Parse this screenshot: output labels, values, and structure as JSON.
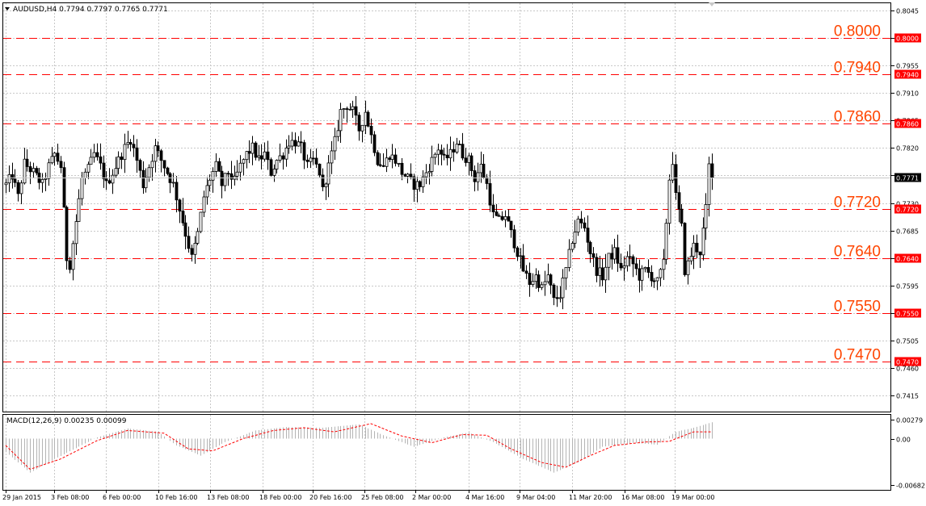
{
  "window": {
    "symbol_header": "AUDUSD,H4 0.7794 0.7797 0.7765 0.7771",
    "menu_icon": "triangle-down-icon"
  },
  "colors": {
    "level": "#ff0000",
    "level_text": "#ff4500",
    "candle": "#000000",
    "grid": "#c8c8c8",
    "macd_hist": "#b4b4b4",
    "macd_signal": "#ff0000"
  },
  "chart_data": [
    {
      "type": "candlestick",
      "title": "AUDUSD,H4 0.7794 0.7797 0.7765 0.7771",
      "ylim": [
        0.7415,
        0.8045
      ],
      "y_ticks": [
        "0.8045",
        "0.8000",
        "0.7955",
        "0.7910",
        "0.7865",
        "0.7820",
        "0.7775",
        "0.7730",
        "0.7685",
        "0.7640",
        "0.7595",
        "0.7550",
        "0.7505",
        "0.7460",
        "0.7415"
      ],
      "x_ticks": [
        "29 Jan 2015",
        "3 Feb 08:00",
        "6 Feb 00:00",
        "10 Feb 16:00",
        "13 Feb 08:00",
        "18 Feb 00:00",
        "20 Feb 16:00",
        "25 Feb 08:00",
        "2 Mar 00:00",
        "4 Mar 16:00",
        "9 Mar 04:00",
        "11 Mar 20:00",
        "16 Mar 08:00",
        "19 Mar 00:00"
      ],
      "current_price": "0.7771",
      "levels": [
        {
          "value": 0.8,
          "label": "0.8000"
        },
        {
          "value": 0.794,
          "label": "0.7940"
        },
        {
          "value": 0.786,
          "label": "0.7860"
        },
        {
          "value": 0.772,
          "label": "0.7720"
        },
        {
          "value": 0.764,
          "label": "0.7640"
        },
        {
          "value": 0.755,
          "label": "0.7550"
        },
        {
          "value": 0.747,
          "label": "0.7470"
        }
      ],
      "close_path": [
        [
          0,
          0.776
        ],
        [
          2,
          0.7775
        ],
        [
          4,
          0.774
        ],
        [
          6,
          0.7795
        ],
        [
          9,
          0.778
        ],
        [
          12,
          0.776
        ],
        [
          14,
          0.779
        ],
        [
          16,
          0.781
        ],
        [
          18,
          0.779
        ],
        [
          20,
          0.764
        ],
        [
          21,
          0.763
        ],
        [
          23,
          0.77
        ],
        [
          25,
          0.777
        ],
        [
          27,
          0.7785
        ],
        [
          29,
          0.781
        ],
        [
          31,
          0.779
        ],
        [
          33,
          0.776
        ],
        [
          35,
          0.778
        ],
        [
          37,
          0.78
        ],
        [
          39,
          0.782
        ],
        [
          41,
          0.7835
        ],
        [
          43,
          0.78
        ],
        [
          45,
          0.776
        ],
        [
          47,
          0.779
        ],
        [
          49,
          0.782
        ],
        [
          51,
          0.78
        ],
        [
          53,
          0.778
        ],
        [
          55,
          0.776
        ],
        [
          57,
          0.772
        ],
        [
          59,
          0.768
        ],
        [
          61,
          0.764
        ],
        [
          63,
          0.768
        ],
        [
          65,
          0.774
        ],
        [
          67,
          0.777
        ],
        [
          69,
          0.779
        ],
        [
          71,
          0.776
        ],
        [
          73,
          0.778
        ],
        [
          75,
          0.7765
        ],
        [
          77,
          0.779
        ],
        [
          79,
          0.781
        ],
        [
          81,
          0.782
        ],
        [
          83,
          0.78
        ],
        [
          85,
          0.781
        ],
        [
          87,
          0.778
        ],
        [
          89,
          0.78
        ],
        [
          91,
          0.781
        ],
        [
          93,
          0.783
        ],
        [
          95,
          0.783
        ],
        [
          97,
          0.782
        ],
        [
          99,
          0.779
        ],
        [
          101,
          0.78
        ],
        [
          103,
          0.778
        ],
        [
          104,
          0.775
        ],
        [
          106,
          0.779
        ],
        [
          108,
          0.783
        ],
        [
          110,
          0.788
        ],
        [
          112,
          0.789
        ],
        [
          114,
          0.788
        ],
        [
          116,
          0.785
        ],
        [
          118,
          0.788
        ],
        [
          120,
          0.784
        ],
        [
          122,
          0.78
        ],
        [
          124,
          0.779
        ],
        [
          126,
          0.781
        ],
        [
          128,
          0.78
        ],
        [
          130,
          0.778
        ],
        [
          132,
          0.777
        ],
        [
          134,
          0.776
        ],
        [
          136,
          0.776
        ],
        [
          138,
          0.778
        ],
        [
          140,
          0.78
        ],
        [
          142,
          0.782
        ],
        [
          144,
          0.78
        ],
        [
          146,
          0.781
        ],
        [
          148,
          0.783
        ],
        [
          150,
          0.781
        ],
        [
          152,
          0.78
        ],
        [
          154,
          0.777
        ],
        [
          156,
          0.779
        ],
        [
          158,
          0.776
        ],
        [
          160,
          0.771
        ],
        [
          162,
          0.77
        ],
        [
          164,
          0.771
        ],
        [
          166,
          0.768
        ],
        [
          168,
          0.765
        ],
        [
          170,
          0.762
        ],
        [
          172,
          0.76
        ],
        [
          174,
          0.761
        ],
        [
          176,
          0.759
        ],
        [
          178,
          0.761
        ],
        [
          180,
          0.757
        ],
        [
          182,
          0.758
        ],
        [
          184,
          0.762
        ],
        [
          186,
          0.767
        ],
        [
          188,
          0.77
        ],
        [
          190,
          0.769
        ],
        [
          192,
          0.765
        ],
        [
          194,
          0.762
        ],
        [
          196,
          0.761
        ],
        [
          198,
          0.764
        ],
        [
          200,
          0.765
        ],
        [
          202,
          0.762
        ],
        [
          204,
          0.764
        ],
        [
          206,
          0.763
        ],
        [
          208,
          0.761
        ],
        [
          210,
          0.762
        ],
        [
          212,
          0.761
        ],
        [
          214,
          0.76
        ],
        [
          216,
          0.763
        ],
        [
          218,
          0.777
        ],
        [
          219,
          0.78
        ],
        [
          220,
          0.774
        ],
        [
          222,
          0.769
        ],
        [
          223,
          0.762
        ],
        [
          224,
          0.763
        ],
        [
          226,
          0.766
        ],
        [
          228,
          0.765
        ],
        [
          230,
          0.772
        ],
        [
          231,
          0.779
        ],
        [
          232,
          0.7771
        ]
      ]
    },
    {
      "type": "histogram",
      "title": "MACD(12,26,9) 0.00235 0.00099",
      "ylim": [
        -0.00682,
        0.00279
      ],
      "y_ticks": [
        "0.00279",
        "0.00",
        "-0.00682"
      ],
      "macd_path": [
        [
          0,
          -0.002
        ],
        [
          8,
          -0.005
        ],
        [
          16,
          -0.003
        ],
        [
          30,
          0.0002
        ],
        [
          40,
          0.0015
        ],
        [
          50,
          0.001
        ],
        [
          56,
          -0.001
        ],
        [
          64,
          -0.0025
        ],
        [
          72,
          -0.0005
        ],
        [
          82,
          0.0012
        ],
        [
          92,
          0.0017
        ],
        [
          104,
          0.0016
        ],
        [
          116,
          0.0021
        ],
        [
          124,
          0.0005
        ],
        [
          134,
          -0.0012
        ],
        [
          144,
          0.0002
        ],
        [
          152,
          0.0009
        ],
        [
          160,
          -0.0005
        ],
        [
          170,
          -0.003
        ],
        [
          180,
          -0.005
        ],
        [
          188,
          -0.0035
        ],
        [
          196,
          -0.0012
        ],
        [
          206,
          -0.0006
        ],
        [
          214,
          -0.0009
        ],
        [
          220,
          0.001
        ],
        [
          226,
          0.0016
        ],
        [
          232,
          0.0024
        ]
      ],
      "signal_path": [
        [
          0,
          -0.001
        ],
        [
          8,
          -0.0045
        ],
        [
          18,
          -0.003
        ],
        [
          30,
          -0.0003
        ],
        [
          40,
          0.0012
        ],
        [
          52,
          0.0008
        ],
        [
          60,
          -0.0015
        ],
        [
          68,
          -0.0018
        ],
        [
          78,
          0.0
        ],
        [
          88,
          0.0012
        ],
        [
          98,
          0.0016
        ],
        [
          108,
          0.001
        ],
        [
          120,
          0.0022
        ],
        [
          130,
          0.0004
        ],
        [
          140,
          -0.0006
        ],
        [
          150,
          0.0006
        ],
        [
          158,
          0.0005
        ],
        [
          166,
          -0.0015
        ],
        [
          176,
          -0.0035
        ],
        [
          184,
          -0.0042
        ],
        [
          192,
          -0.0025
        ],
        [
          200,
          -0.001
        ],
        [
          210,
          -0.0005
        ],
        [
          218,
          -0.0004
        ],
        [
          226,
          0.001
        ],
        [
          232,
          0.001
        ]
      ]
    }
  ]
}
